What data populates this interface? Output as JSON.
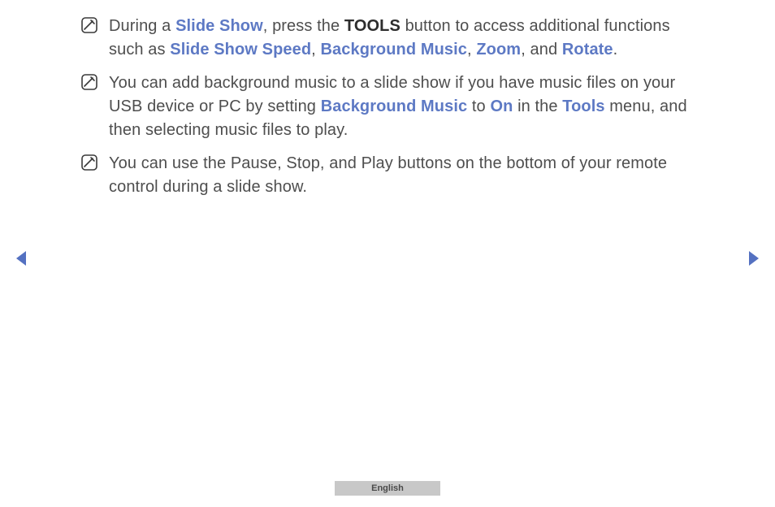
{
  "notes": [
    {
      "segments": [
        {
          "text": "During a ",
          "style": "normal"
        },
        {
          "text": "Slide Show",
          "style": "blue-bold"
        },
        {
          "text": ", press the ",
          "style": "normal"
        },
        {
          "text": "TOOLS",
          "style": "bold"
        },
        {
          "text": " button to access additional functions such as ",
          "style": "normal"
        },
        {
          "text": "Slide Show Speed",
          "style": "blue-bold"
        },
        {
          "text": ", ",
          "style": "normal"
        },
        {
          "text": "Background Music",
          "style": "blue-bold"
        },
        {
          "text": ", ",
          "style": "normal"
        },
        {
          "text": "Zoom",
          "style": "blue-bold"
        },
        {
          "text": ", and ",
          "style": "normal"
        },
        {
          "text": "Rotate",
          "style": "blue-bold"
        },
        {
          "text": ".",
          "style": "normal"
        }
      ]
    },
    {
      "segments": [
        {
          "text": "You can add background music to a slide show if you have music files on your USB device or PC by setting ",
          "style": "normal"
        },
        {
          "text": "Background Music",
          "style": "blue-bold"
        },
        {
          "text": " to ",
          "style": "normal"
        },
        {
          "text": "On",
          "style": "blue-bold"
        },
        {
          "text": " in the ",
          "style": "normal"
        },
        {
          "text": "Tools",
          "style": "blue-bold"
        },
        {
          "text": " menu, and then selecting music files to play.",
          "style": "normal"
        }
      ]
    },
    {
      "segments": [
        {
          "text": "You can use the Pause, Stop, and Play buttons on the bottom of your remote control during a slide show.",
          "style": "normal"
        }
      ]
    }
  ],
  "footer": {
    "language": "English"
  },
  "colors": {
    "blue": "#5d79c4",
    "text": "#4e4e4e",
    "arrow": "#5471c1",
    "footerBg": "#c8c8c8"
  }
}
